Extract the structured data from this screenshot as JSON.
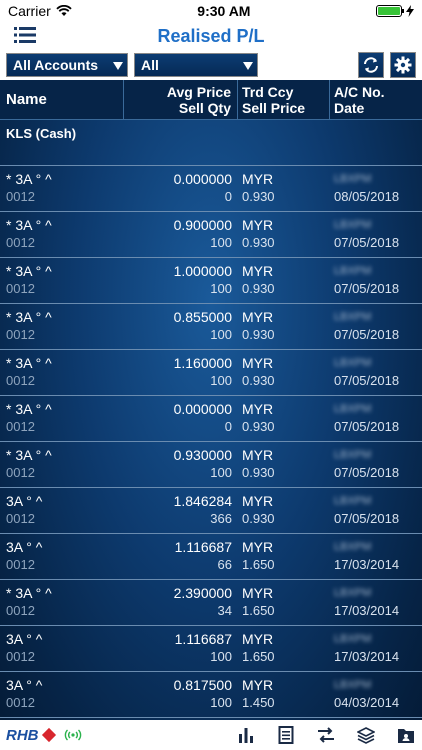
{
  "status": {
    "carrier": "Carrier",
    "time": "9:30 AM"
  },
  "nav": {
    "title": "Realised P/L"
  },
  "filters": {
    "account": "All Accounts",
    "type": "All"
  },
  "columns": {
    "name": "Name",
    "price_h1": "Avg Price",
    "price_h2": "Sell Qty",
    "ccy_h1": "Trd Ccy",
    "ccy_h2": "Sell Price",
    "ac_h1": "A/C No.",
    "ac_h2": "Date"
  },
  "group": "KLS (Cash)",
  "rows": [
    {
      "name": "* 3A ° ^",
      "code": "0012",
      "avg": "0.000000",
      "qty": "0",
      "ccy": "MYR",
      "sell": "0.930",
      "ac": "LBXPM",
      "date": "08/05/2018"
    },
    {
      "name": "* 3A ° ^",
      "code": "0012",
      "avg": "0.900000",
      "qty": "100",
      "ccy": "MYR",
      "sell": "0.930",
      "ac": "LBXPM",
      "date": "07/05/2018"
    },
    {
      "name": "* 3A ° ^",
      "code": "0012",
      "avg": "1.000000",
      "qty": "100",
      "ccy": "MYR",
      "sell": "0.930",
      "ac": "LBXPM",
      "date": "07/05/2018"
    },
    {
      "name": "* 3A ° ^",
      "code": "0012",
      "avg": "0.855000",
      "qty": "100",
      "ccy": "MYR",
      "sell": "0.930",
      "ac": "LBXPM",
      "date": "07/05/2018"
    },
    {
      "name": "* 3A ° ^",
      "code": "0012",
      "avg": "1.160000",
      "qty": "100",
      "ccy": "MYR",
      "sell": "0.930",
      "ac": "LBXPM",
      "date": "07/05/2018"
    },
    {
      "name": "* 3A ° ^",
      "code": "0012",
      "avg": "0.000000",
      "qty": "0",
      "ccy": "MYR",
      "sell": "0.930",
      "ac": "LBXPM",
      "date": "07/05/2018"
    },
    {
      "name": "* 3A ° ^",
      "code": "0012",
      "avg": "0.930000",
      "qty": "100",
      "ccy": "MYR",
      "sell": "0.930",
      "ac": "LBXPM",
      "date": "07/05/2018"
    },
    {
      "name": "3A ° ^",
      "code": "0012",
      "avg": "1.846284",
      "qty": "366",
      "ccy": "MYR",
      "sell": "0.930",
      "ac": "LBXPM",
      "date": "07/05/2018"
    },
    {
      "name": "3A ° ^",
      "code": "0012",
      "avg": "1.116687",
      "qty": "66",
      "ccy": "MYR",
      "sell": "1.650",
      "ac": "LBXPM",
      "date": "17/03/2014"
    },
    {
      "name": "* 3A ° ^",
      "code": "0012",
      "avg": "2.390000",
      "qty": "34",
      "ccy": "MYR",
      "sell": "1.650",
      "ac": "LBXPM",
      "date": "17/03/2014"
    },
    {
      "name": "3A ° ^",
      "code": "0012",
      "avg": "1.116687",
      "qty": "100",
      "ccy": "MYR",
      "sell": "1.650",
      "ac": "LBXPM",
      "date": "17/03/2014"
    },
    {
      "name": "3A ° ^",
      "code": "0012",
      "avg": "0.817500",
      "qty": "100",
      "ccy": "MYR",
      "sell": "1.450",
      "ac": "LBXPM",
      "date": "04/03/2014"
    }
  ],
  "tabbar": {
    "logo": "RHB"
  },
  "colors": {
    "accent": "#1f6fc7",
    "background": "#0d3a6e",
    "brand_red": "#d8262d"
  },
  "icons": [
    "wifi-icon",
    "battery-icon",
    "menu-icon",
    "refresh-icon",
    "gear-icon",
    "signal-icon",
    "chart-icon",
    "document-icon",
    "currency-exchange-icon",
    "layers-icon",
    "portfolio-icon"
  ]
}
